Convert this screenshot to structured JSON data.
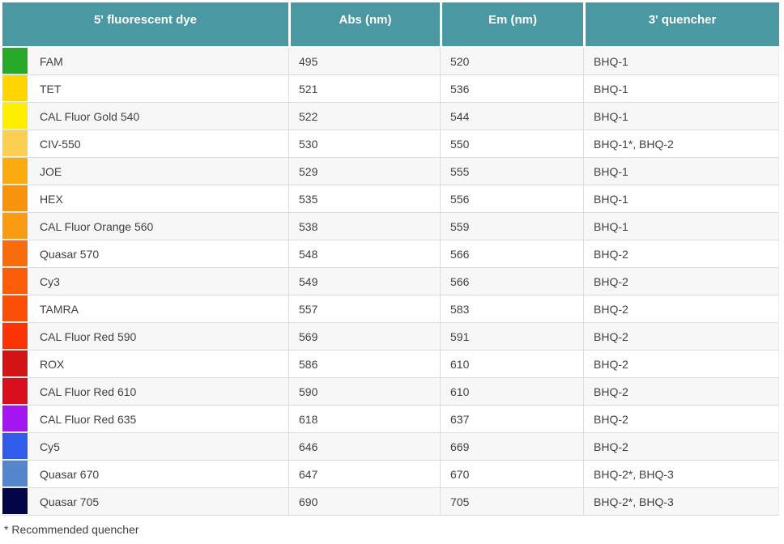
{
  "colors": {
    "header_bg": "#4A98A2",
    "header_text": "#FFFFFF",
    "row_alt_bg": "#F7F7F7",
    "row_bg": "#FFFFFF",
    "grid_border": "#DCDCDC",
    "body_text": "#404040"
  },
  "table": {
    "headers": [
      "5' fluorescent dye",
      "Abs (nm)",
      "Em (nm)",
      "3' quencher"
    ],
    "rows": [
      {
        "dye": "FAM",
        "color": "#28A828",
        "abs": "495",
        "em": "520",
        "quencher": "BHQ-1"
      },
      {
        "dye": "TET",
        "color": "#FFD400",
        "abs": "521",
        "em": "536",
        "quencher": "BHQ-1"
      },
      {
        "dye": "CAL Fluor Gold 540",
        "color": "#FDEE00",
        "abs": "522",
        "em": "544",
        "quencher": "BHQ-1"
      },
      {
        "dye": "CIV-550",
        "color": "#FBCE52",
        "abs": "530",
        "em": "550",
        "quencher": "BHQ-1*, BHQ-2"
      },
      {
        "dye": "JOE",
        "color": "#FCAB0E",
        "abs": "529",
        "em": "555",
        "quencher": "BHQ-1"
      },
      {
        "dye": "HEX",
        "color": "#F8930E",
        "abs": "535",
        "em": "556",
        "quencher": "BHQ-1"
      },
      {
        "dye": "CAL Fluor Orange 560",
        "color": "#F99B13",
        "abs": "538",
        "em": "559",
        "quencher": "BHQ-1"
      },
      {
        "dye": "Quasar 570",
        "color": "#F86C0D",
        "abs": "548",
        "em": "566",
        "quencher": "BHQ-2"
      },
      {
        "dye": "Cy3",
        "color": "#FB5C07",
        "abs": "549",
        "em": "566",
        "quencher": "BHQ-2"
      },
      {
        "dye": "TAMRA",
        "color": "#FB4E06",
        "abs": "557",
        "em": "583",
        "quencher": "BHQ-2"
      },
      {
        "dye": "CAL Fluor Red 590",
        "color": "#F93508",
        "abs": "569",
        "em": "591",
        "quencher": "BHQ-2"
      },
      {
        "dye": "ROX",
        "color": "#D31414",
        "abs": "586",
        "em": "610",
        "quencher": "BHQ-2"
      },
      {
        "dye": "CAL Fluor Red 610",
        "color": "#DA0F1E",
        "abs": "590",
        "em": "610",
        "quencher": "BHQ-2"
      },
      {
        "dye": "CAL Fluor Red 635",
        "color": "#A316F2",
        "abs": "618",
        "em": "637",
        "quencher": "BHQ-2"
      },
      {
        "dye": "Cy5",
        "color": "#2F5CEB",
        "abs": "646",
        "em": "669",
        "quencher": "BHQ-2"
      },
      {
        "dye": "Quasar 670",
        "color": "#5585CB",
        "abs": "647",
        "em": "670",
        "quencher": "BHQ-2*, BHQ-3"
      },
      {
        "dye": "Quasar 705",
        "color": "#040449",
        "abs": "690",
        "em": "705",
        "quencher": "BHQ-2*, BHQ-3"
      }
    ]
  },
  "footnote": "* Recommended quencher"
}
